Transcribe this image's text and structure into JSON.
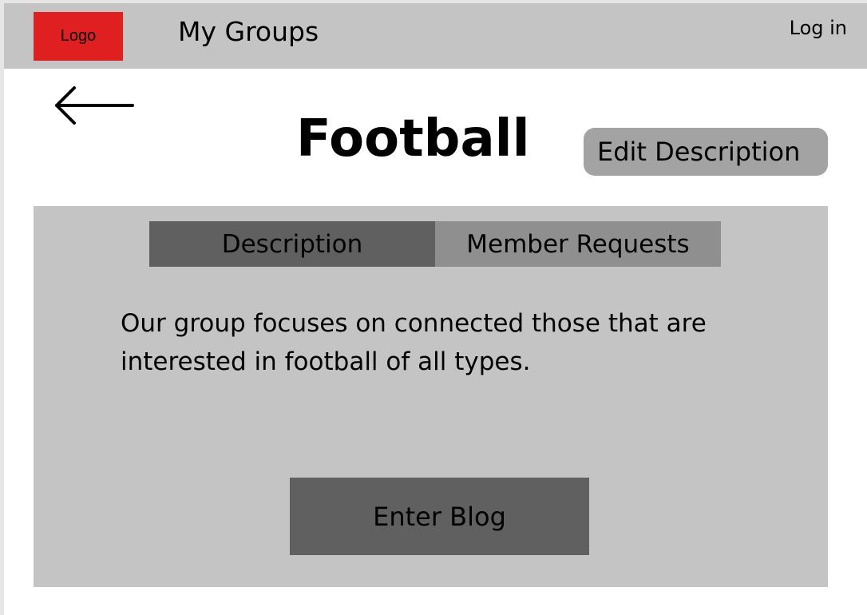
{
  "header": {
    "logo_label": "Logo",
    "nav_title": "My Groups",
    "login_label": "Log in"
  },
  "page": {
    "back_icon": "arrow-left-icon",
    "title": "Football",
    "edit_label": "Edit Description"
  },
  "tabs": [
    {
      "label": "Description",
      "active": true
    },
    {
      "label": "Member Requests",
      "active": false
    }
  ],
  "content": {
    "description": "Our group focuses on connected those that are interested in football of all types.",
    "blog_button_label": "Enter Blog"
  },
  "colors": {
    "logo": "#e02020",
    "topbar": "#c4c4c4",
    "panel": "#c4c4c4",
    "active_tab": "#606060",
    "inactive_tab": "#8f8f8f",
    "edit_button": "#a3a3a3",
    "blog_button": "#606060"
  }
}
